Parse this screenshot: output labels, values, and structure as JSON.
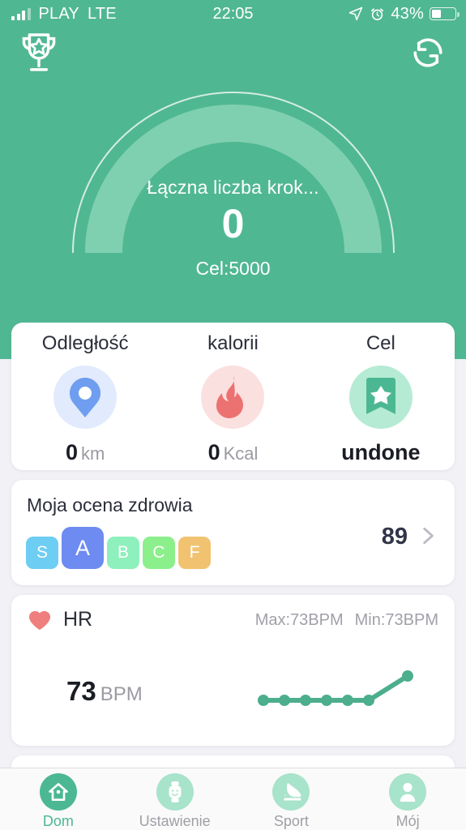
{
  "status_bar": {
    "carrier": "PLAY",
    "network": "LTE",
    "time": "22:05",
    "battery_percent": "43%",
    "icons": [
      "signal-bars-icon",
      "location-arrow-icon",
      "alarm-clock-icon",
      "battery-icon"
    ]
  },
  "header": {
    "trophy_icon": "trophy-icon",
    "sync_icon": "sync-icon",
    "steps_label": "Łączna liczba krok...",
    "steps_value": "0",
    "goal_label": "Cel:5000",
    "bg_color": "#50b793",
    "arc_color": "#7fd0b1"
  },
  "stats": {
    "items": [
      {
        "title": "Odległość",
        "value": "0",
        "unit": "km",
        "icon": "location-pin-icon",
        "color": "#6f9ef0"
      },
      {
        "title": "kalorii",
        "value": "0",
        "unit": "Kcal",
        "icon": "flame-icon",
        "color": "#ec7272"
      },
      {
        "title": "Cel",
        "value": "undone",
        "unit": "",
        "icon": "goal-badge-star-icon",
        "color": "#4cb893"
      }
    ]
  },
  "health": {
    "title": "Moja ocena zdrowia",
    "score": "89",
    "chevron_icon": "chevron-right-icon",
    "grades": [
      {
        "label": "S",
        "color": "#6ecdf2",
        "active": false
      },
      {
        "label": "A",
        "color": "#6d8bf0",
        "active": true
      },
      {
        "label": "B",
        "color": "#8ef0bc",
        "active": false
      },
      {
        "label": "C",
        "color": "#8bef8b",
        "active": false
      },
      {
        "label": "F",
        "color": "#f1c371",
        "active": false
      }
    ]
  },
  "heart_rate": {
    "icon": "heart-icon",
    "name": "HR",
    "max_label": "Max:73BPM",
    "min_label": "Min:73BPM",
    "value": "73",
    "unit": "BPM",
    "line_color": "#4cae8c"
  },
  "chart_data": {
    "type": "line",
    "title": "HR",
    "x": [
      0,
      1,
      2,
      3,
      4,
      5,
      6
    ],
    "values": [
      73,
      73,
      73,
      73,
      73,
      73,
      82
    ],
    "series": [
      {
        "name": "HR",
        "values": [
          73,
          73,
          73,
          73,
          73,
          73,
          82
        ]
      }
    ],
    "xlabel": "",
    "ylabel": "BPM",
    "ylim": [
      70,
      85
    ],
    "grid": false,
    "legend": "none",
    "marker": "circle",
    "color": "#4cae8c"
  },
  "nav": {
    "items": [
      {
        "label": "Dom",
        "icon": "home-icon",
        "active": true
      },
      {
        "label": "Ustawienie",
        "icon": "smartwatch-icon",
        "active": false
      },
      {
        "label": "Sport",
        "icon": "shoe-icon",
        "active": false
      },
      {
        "label": "Mój",
        "icon": "person-icon",
        "active": false
      }
    ]
  }
}
